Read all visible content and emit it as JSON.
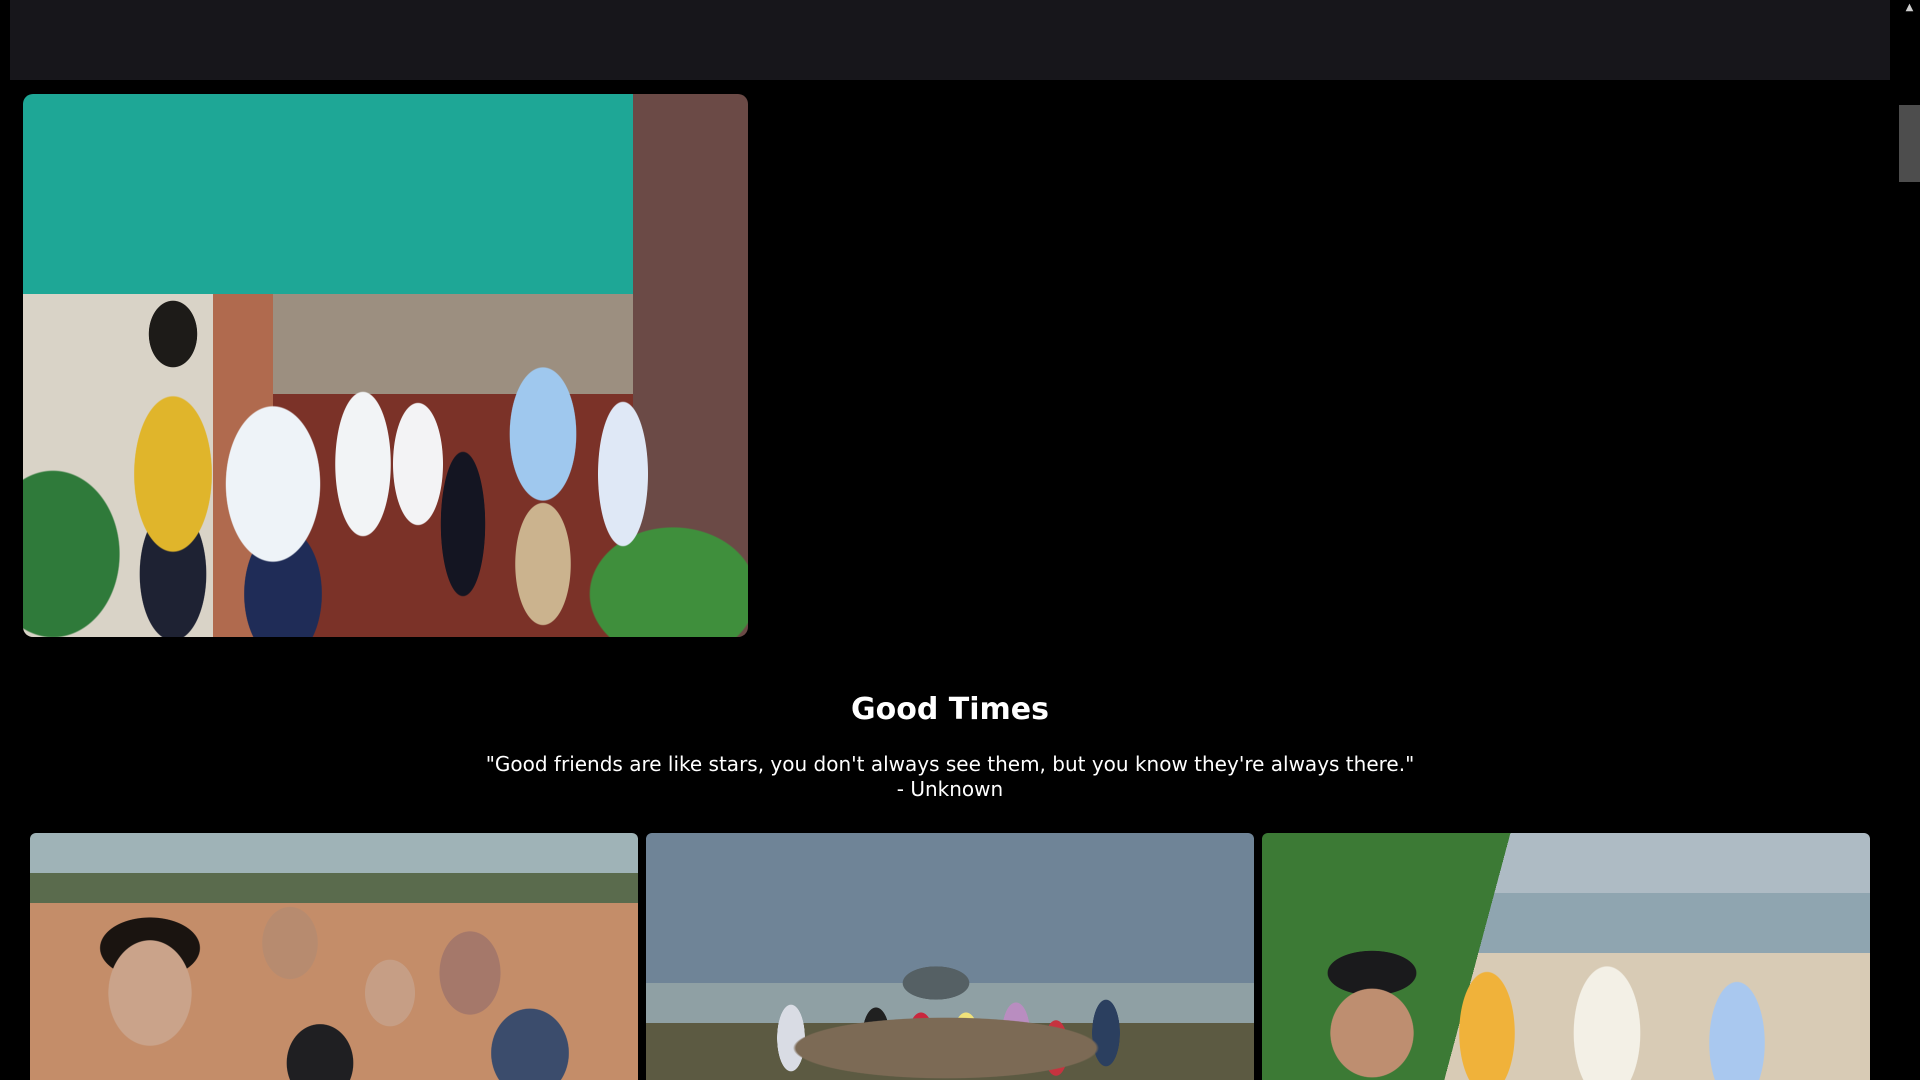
{
  "gallery": {
    "hero_photo_alt": "Group photo",
    "section_title": "Good Times",
    "quote_text": "\"Good friends are like stars, you don't always see them, but you know they're always there.\"",
    "quote_author": "- Unknown",
    "strip_photos": [
      {
        "alt": "Friends selfie"
      },
      {
        "alt": "Friends by the jeep"
      },
      {
        "alt": "Friends by the sea"
      }
    ]
  },
  "colors": {
    "background": "#000000",
    "navbar": "#17161b",
    "text": "#ffffff",
    "scrollbar_thumb": "#4d4d4d"
  },
  "icons": {
    "scroll_up": "chevron-up-icon"
  }
}
